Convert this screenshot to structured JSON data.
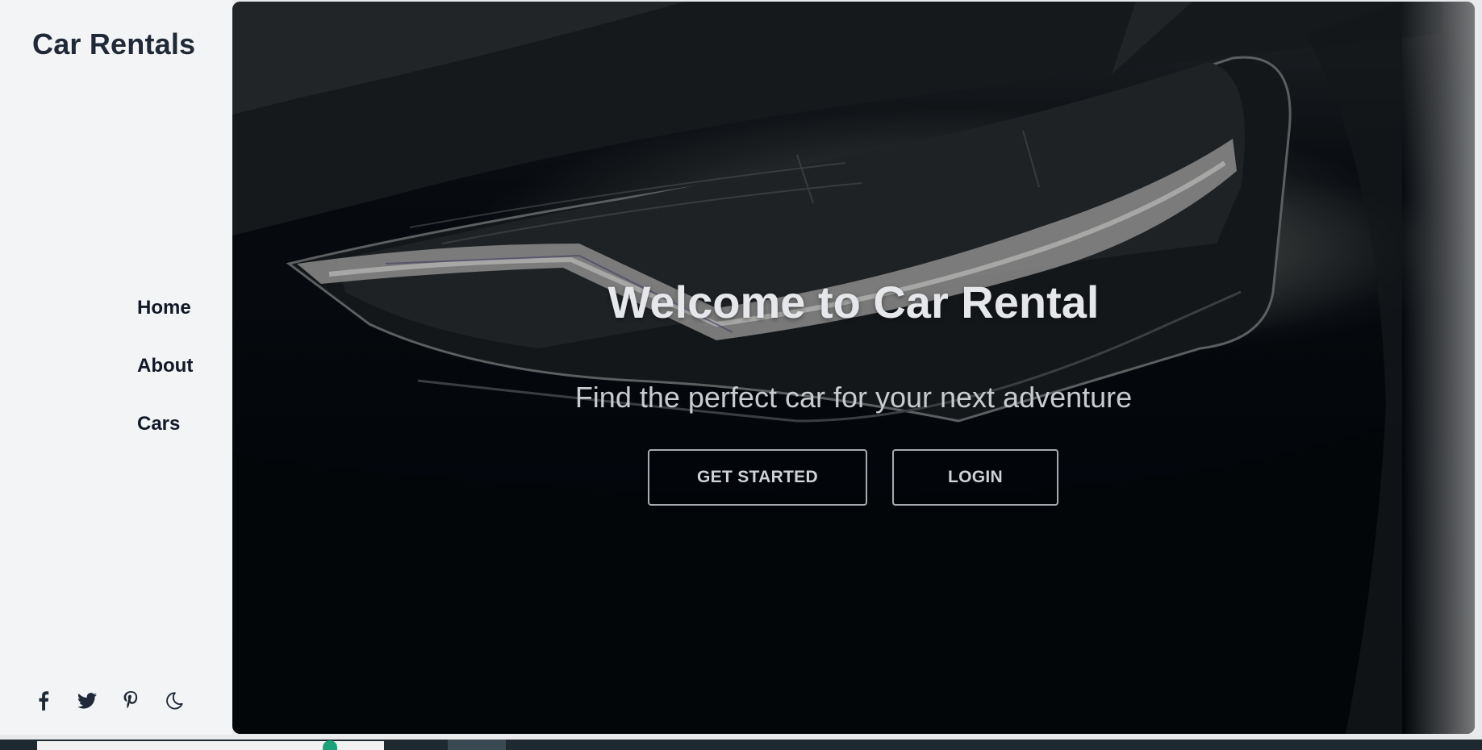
{
  "sidebar": {
    "brand": "Car Rentals",
    "nav": [
      {
        "label": "Home"
      },
      {
        "label": "About"
      },
      {
        "label": "Cars"
      }
    ],
    "social_icons": [
      "facebook-icon",
      "twitter-icon",
      "pinterest-icon",
      "moon-icon"
    ]
  },
  "hero": {
    "title": "Welcome to Car Rental",
    "subtitle": "Find the perfect car for your next adventure",
    "buttons": {
      "get_started": "GET STARTED",
      "login": "LOGIN"
    }
  },
  "colors": {
    "sidebar_bg": "#f3f4f6",
    "brand_text": "#1f2937",
    "hero_dark": "#050a10",
    "button_border": "#a8abb0"
  }
}
